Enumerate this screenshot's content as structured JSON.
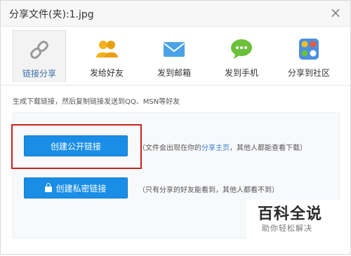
{
  "dialog": {
    "title": "分享文件(夹):1.jpg",
    "close_label": "×"
  },
  "tabs": [
    {
      "label": "链接分享",
      "icon": "link-icon",
      "active": true
    },
    {
      "label": "发给好友",
      "icon": "friends-icon",
      "active": false
    },
    {
      "label": "发到邮箱",
      "icon": "mail-icon",
      "active": false
    },
    {
      "label": "发到手机",
      "icon": "chat-bubble-icon",
      "active": false
    },
    {
      "label": "分享到社区",
      "icon": "community-icon",
      "active": false
    }
  ],
  "panel": {
    "hint": "生成下载链接，然后复制链接发送到QQ、MSN等好友",
    "public_button": "创建公开链接",
    "public_desc_before": "（文件会出现在你的",
    "public_desc_link": "分享主页",
    "public_desc_after": "，其他人都能查看下载）",
    "private_button": "创建私密链接",
    "private_desc": "（只有分享的好友能看到，其他人都看不到）"
  },
  "watermark": {
    "title": "百科全说",
    "subtitle": "助你轻松解决"
  },
  "colors": {
    "primary_button": "#1a8ee6",
    "highlight_box": "#c8251f",
    "active_tab_text": "#3b6ea8"
  }
}
